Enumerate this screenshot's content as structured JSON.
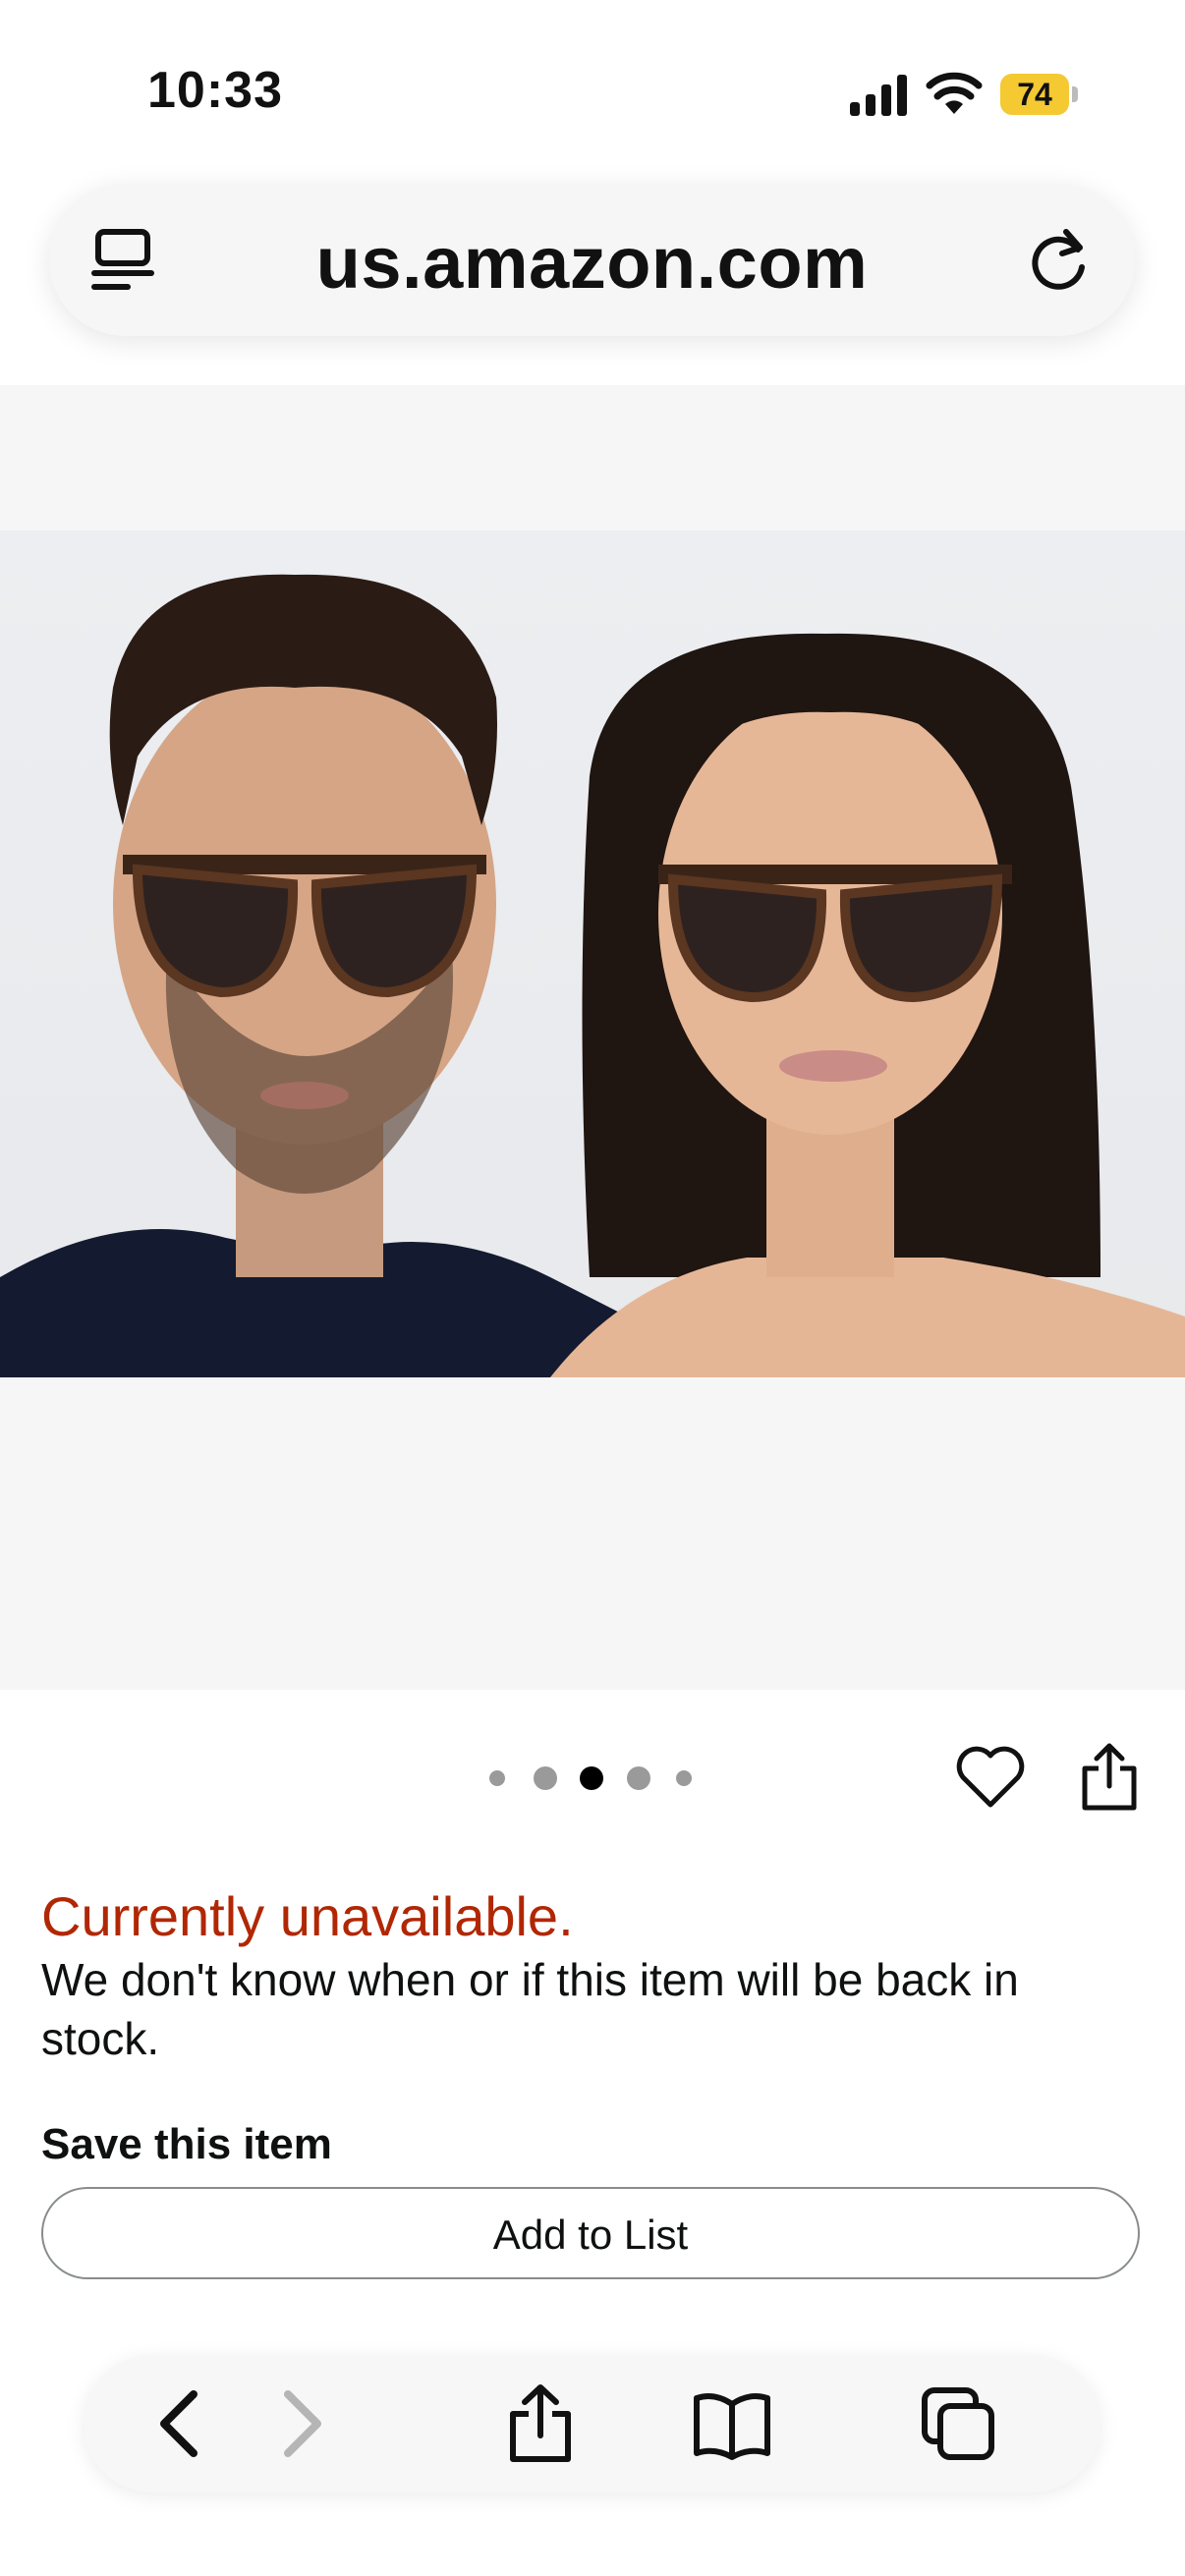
{
  "status": {
    "time": "10:33",
    "battery": "74"
  },
  "browser": {
    "url": "us.amazon.com"
  },
  "gallery": {
    "dot_count": 5,
    "active_dot_index": 2
  },
  "product": {
    "availability": "Currently unavailable.",
    "availability_detail": "We don't know when or if this item will be back in stock.",
    "save_label": "Save this item",
    "add_to_list": "Add to List"
  },
  "colors": {
    "unavailable_red": "#b12704",
    "battery_yellow": "#f4c932"
  },
  "icons": {
    "tabs_menu": "tab-overview-icon",
    "reload": "reload-icon",
    "favorite": "heart-icon",
    "share": "share-icon",
    "back": "chevron-left-icon",
    "forward": "chevron-right-icon",
    "bookmarks": "book-icon",
    "tabs": "tabs-icon"
  }
}
